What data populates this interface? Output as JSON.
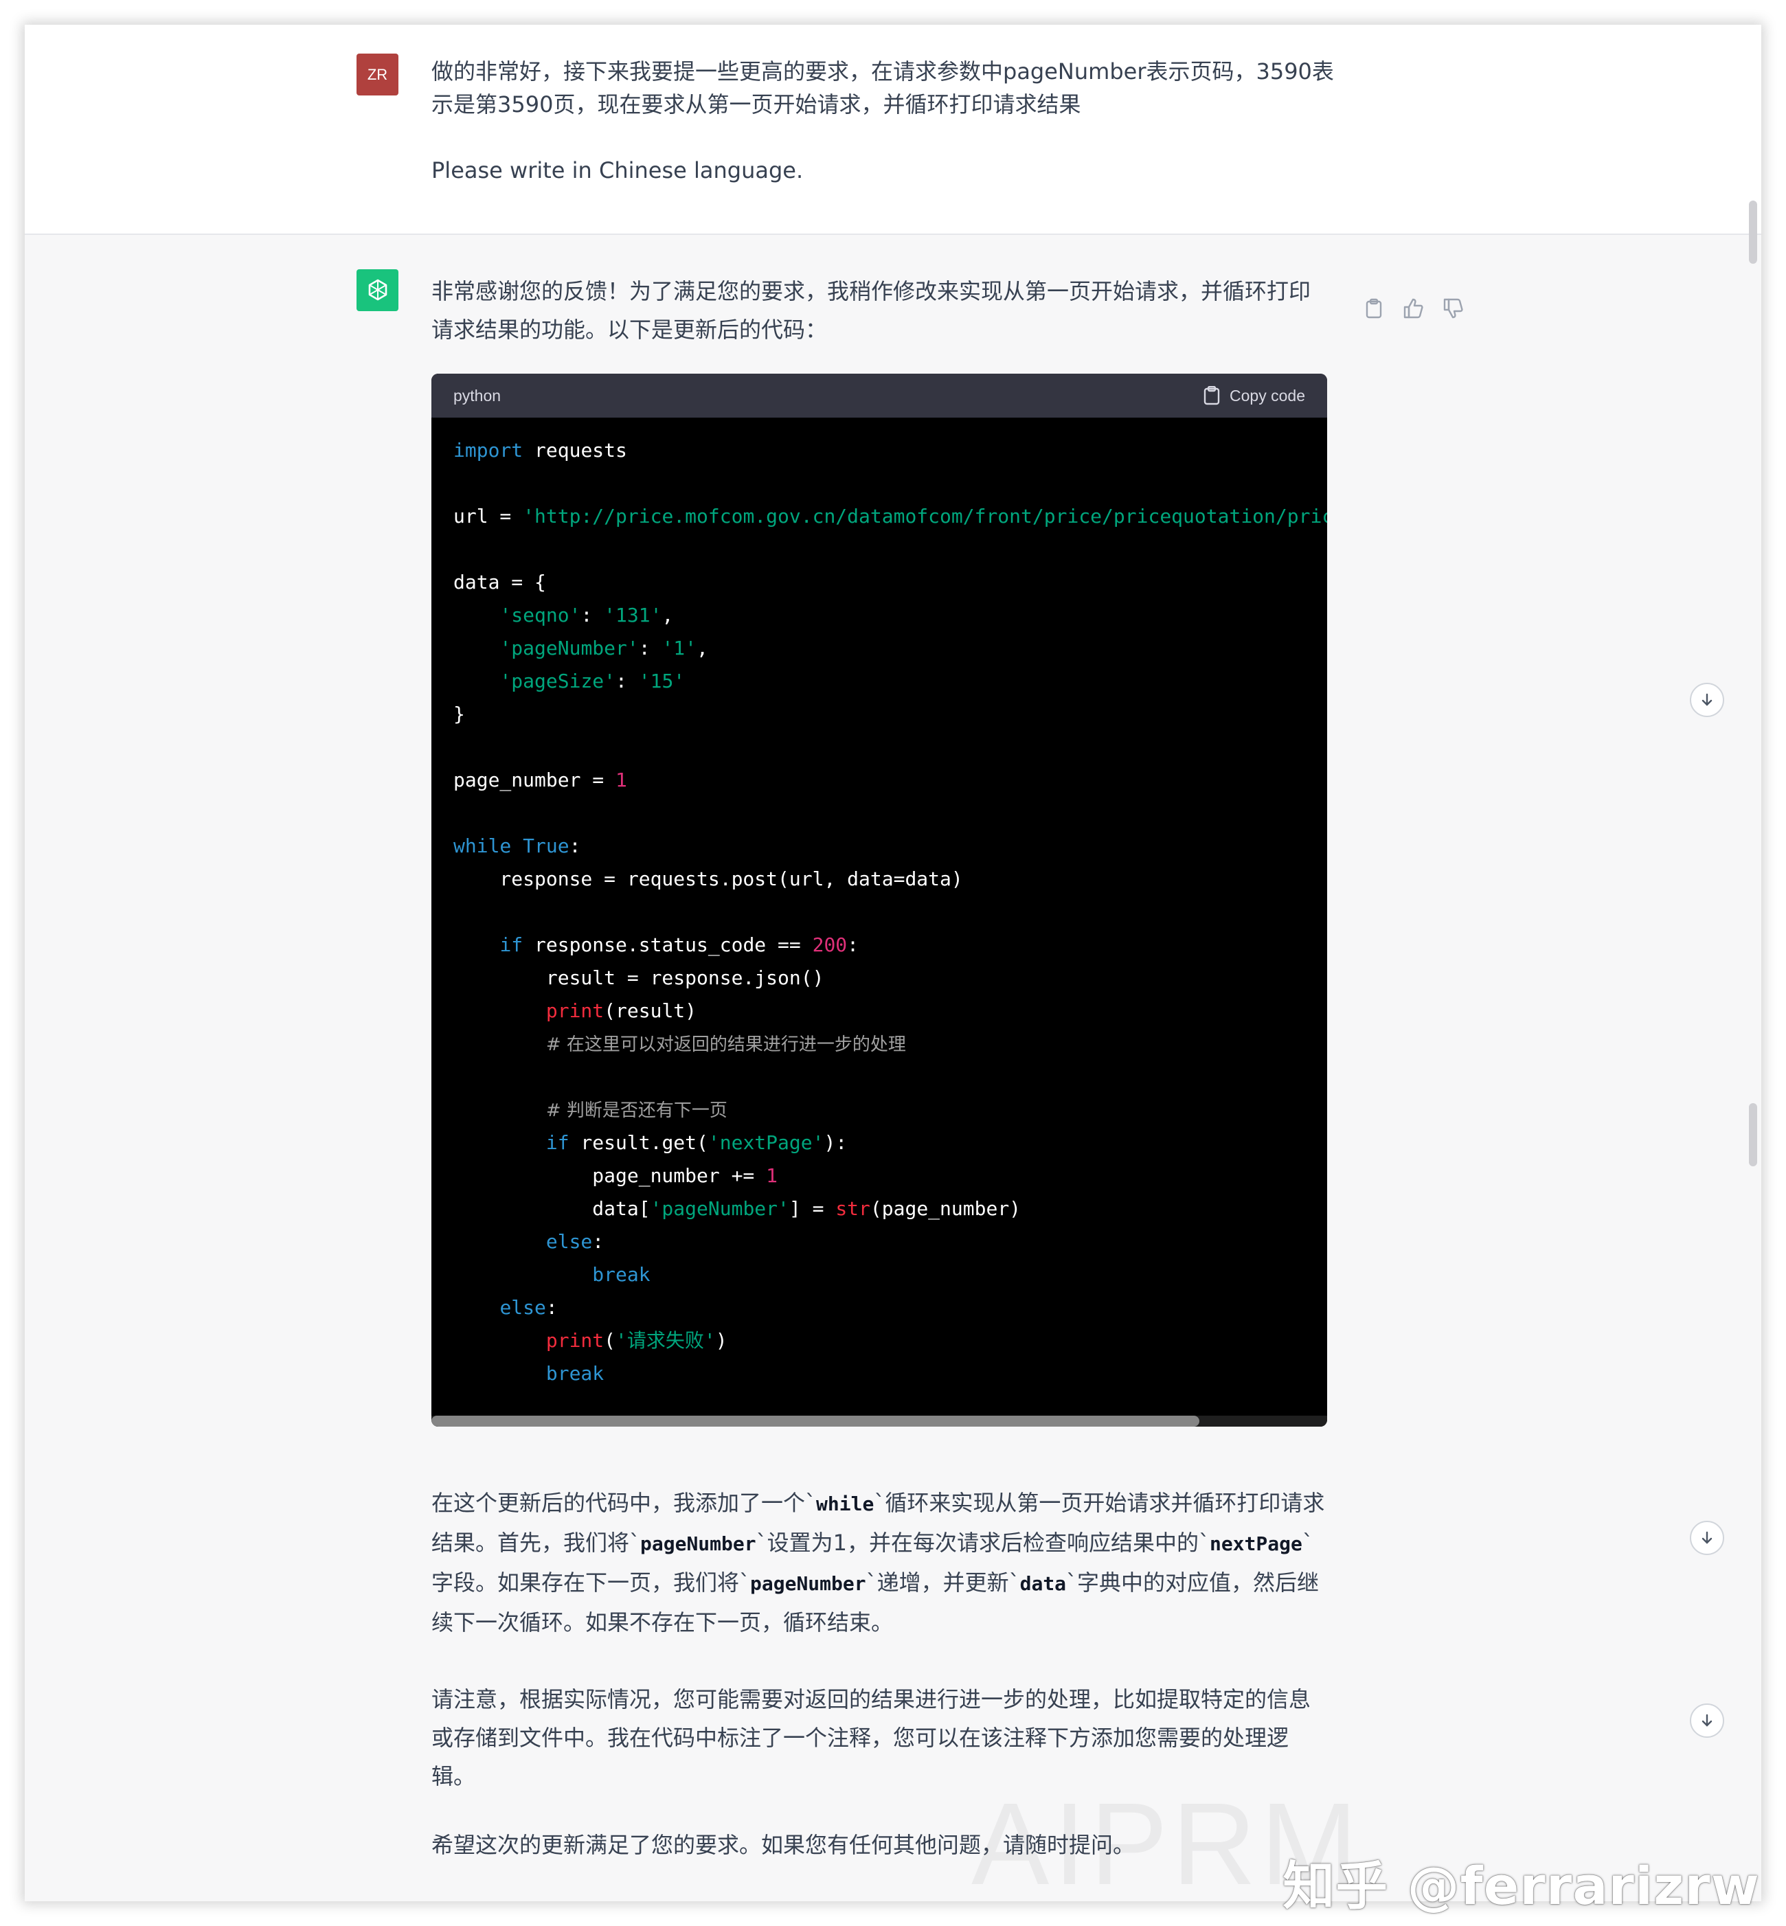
{
  "user": {
    "avatar_initials": "ZR",
    "line1": "做的非常好，接下来我要提一些更高的要求，在请求参数中pageNumber表示页码，3590表",
    "line2": "示是第3590页，现在要求从第一页开始请求，并循环打印请求结果",
    "line3": "Please write in Chinese language."
  },
  "assistant": {
    "intro_line1": "非常感谢您的反馈！为了满足您的要求，我稍作修改来实现从第一页开始请求，并循环打印",
    "intro_line2": "请求结果的功能。以下是更新后的代码：",
    "actions": [
      "copy-icon",
      "thumbs-up-icon",
      "thumbs-down-icon"
    ],
    "code": {
      "language": "python",
      "copy_label": "Copy code"
    },
    "para1": {
      "t1": "在这个更新后的代码中，我添加了一个`",
      "c1": "while",
      "t2": "`循环来实现从第一页开始请求并循环打印请求",
      "t3": "结果。首先，我们将`",
      "c2": "pageNumber",
      "t4": "`设置为1，并在每次请求后检查响应结果中的`",
      "c3": "nextPage",
      "t5": "`",
      "t6": "字段。如果存在下一页，我们将`",
      "c4": "pageNumber",
      "t7": "`递增，并更新`",
      "c5": "data",
      "t8": "`字典中的对应值，然后继",
      "t9": "续下一次循环。如果不存在下一页，循环结束。"
    },
    "para2_line1": "请注意，根据实际情况，您可能需要对返回的结果进行进一步的处理，比如提取特定的信息",
    "para2_line2": "或存储到文件中。我在代码中标注了一个注释，您可以在该注释下方添加您需要的处理逻",
    "para2_line3": "辑。",
    "para3": "希望这次的更新满足了您的要求。如果您有任何其他问题，请随时提问。"
  },
  "watermark": "知乎 @ferrarizrw",
  "aiprm_mark": "AIPRM"
}
